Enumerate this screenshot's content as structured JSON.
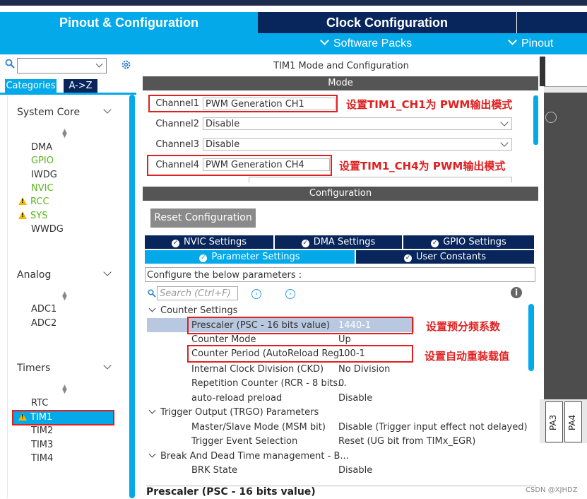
{
  "tabs": {
    "pinout_config": "Pinout & Configuration",
    "clock_config": "Clock Configuration",
    "software_packs": "Software Packs",
    "pinout": "Pinout"
  },
  "left": {
    "categories_tab": "Categories",
    "az_tab": "A->Z",
    "sections": [
      {
        "title": "System Core",
        "items": [
          "DMA",
          "GPIO",
          "IWDG",
          "NVIC",
          "RCC",
          "SYS",
          "WWDG"
        ]
      },
      {
        "title": "Analog",
        "items": [
          "ADC1",
          "ADC2"
        ]
      },
      {
        "title": "Timers",
        "items": [
          "RTC",
          "TIM1",
          "TIM2",
          "TIM3",
          "TIM4"
        ]
      }
    ]
  },
  "mode": {
    "title": "TIM1 Mode and Configuration",
    "header": "Mode",
    "channels": [
      {
        "label": "Channel1",
        "value": "PWM Generation CH1"
      },
      {
        "label": "Channel2",
        "value": "Disable"
      },
      {
        "label": "Channel3",
        "value": "Disable"
      },
      {
        "label": "Channel4",
        "value": "PWM Generation CH4"
      }
    ],
    "annotation_ch1": "设置TIM1_CH1为 PWM输出模式",
    "annotation_ch4": "设置TIM1_CH4为 PWM输出模式"
  },
  "config": {
    "header": "Configuration",
    "reset_button": "Reset Configuration",
    "settings_tabs": [
      "NVIC Settings",
      "DMA Settings",
      "GPIO Settings",
      "Parameter Settings",
      "User Constants"
    ],
    "configure_label": "Configure the below parameters :",
    "search_placeholder": "Search (Ctrl+F)",
    "groups": [
      {
        "title": "Counter Settings"
      },
      {
        "title": "Trigger Output (TRGO) Parameters"
      },
      {
        "title": "Break And Dead Time management - B..."
      }
    ],
    "params": [
      {
        "name": "Prescaler (PSC - 16 bits value)",
        "value": "1440-1"
      },
      {
        "name": "Counter Mode",
        "value": "Up"
      },
      {
        "name": "Counter Period (AutoReload Reg...",
        "value": "100-1"
      },
      {
        "name": "Internal Clock Division (CKD)",
        "value": "No Division"
      },
      {
        "name": "Repetition Counter (RCR - 8 bits...",
        "value": "0"
      },
      {
        "name": "auto-reload preload",
        "value": "Disable"
      },
      {
        "name": "Master/Slave Mode (MSM bit)",
        "value": "Disable (Trigger input effect not delayed)"
      },
      {
        "name": "Trigger Event Selection",
        "value": "Reset (UG bit from TIMx_EGR)"
      },
      {
        "name": "BRK State",
        "value": "Disable"
      }
    ],
    "annotation_prescaler": "设置预分频系数",
    "annotation_period": "设置自动重装载值",
    "bottom_title": "Prescaler (PSC - 16 bits value)"
  },
  "pins": [
    "PA3",
    "PA4"
  ],
  "watermark": "CSDN @XJHDZ",
  "colors": {
    "accent": "#03a9e8",
    "dark": "#08255c",
    "annotation": "#e02020"
  }
}
